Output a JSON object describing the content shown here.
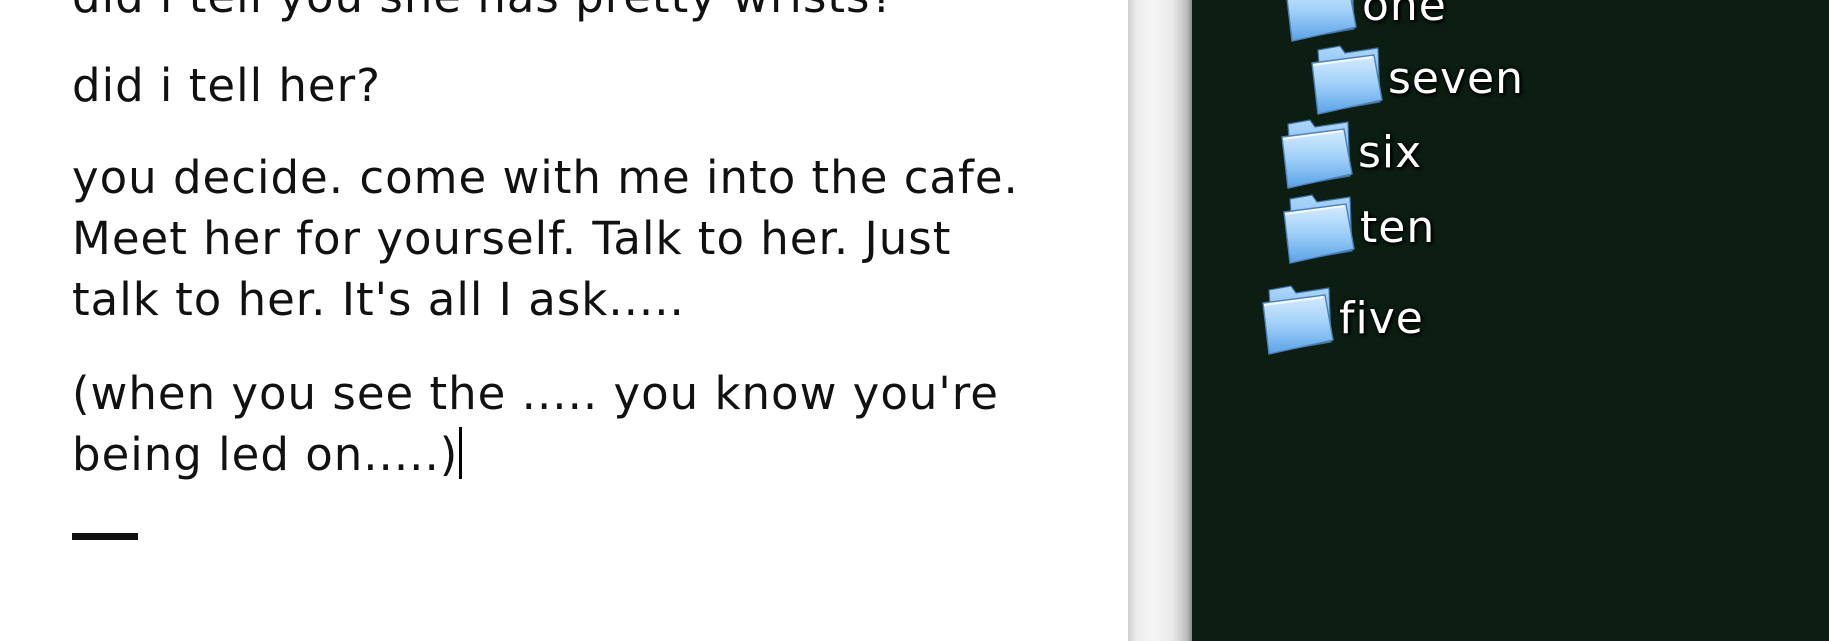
{
  "document": {
    "paragraphs": [
      {
        "lines": [
          "did i tell you she has pretty wrists?"
        ]
      },
      {
        "lines": [
          "did i tell her?"
        ]
      },
      {
        "lines": [
          "you decide. come with me into the cafe.",
          "Meet her for yourself. Talk to her. Just",
          "talk to her. It's all I ask....."
        ]
      },
      {
        "lines": [
          "(when you see the ..... you know you're",
          "being led on.....)"
        ]
      }
    ]
  },
  "desktop": {
    "background": "#0c1d12",
    "folders": [
      {
        "name": "one",
        "icon": "folder-icon"
      },
      {
        "name": "seven",
        "icon": "folder-icon"
      },
      {
        "name": "six",
        "icon": "folder-icon"
      },
      {
        "name": "ten",
        "icon": "folder-icon"
      },
      {
        "name": "five",
        "icon": "folder-icon"
      }
    ]
  }
}
